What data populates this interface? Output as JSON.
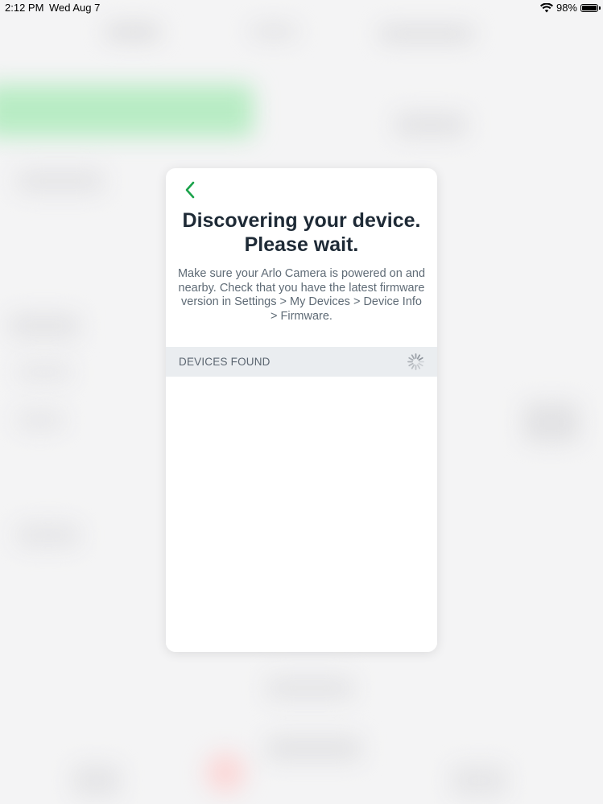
{
  "status_bar": {
    "time": "2:12 PM",
    "date": "Wed Aug 7",
    "battery": "98%",
    "battery_level": 0.98
  },
  "modal": {
    "back_icon": "chevron-left-icon",
    "title_line1": "Discovering your device.",
    "title_line2": "Please wait.",
    "description": "Make sure your Arlo Camera is powered on and nearby. Check that you have the latest firmware version in Settings > My Devices > Device Info > Firmware.",
    "devices_header": "DEVICES FOUND",
    "spinner_icon": "loading-spinner-icon",
    "devices": []
  },
  "colors": {
    "accent": "#1aa24a",
    "title": "#1e2a36",
    "body_text": "#5f6b76",
    "section_bg": "#eaedf0"
  }
}
